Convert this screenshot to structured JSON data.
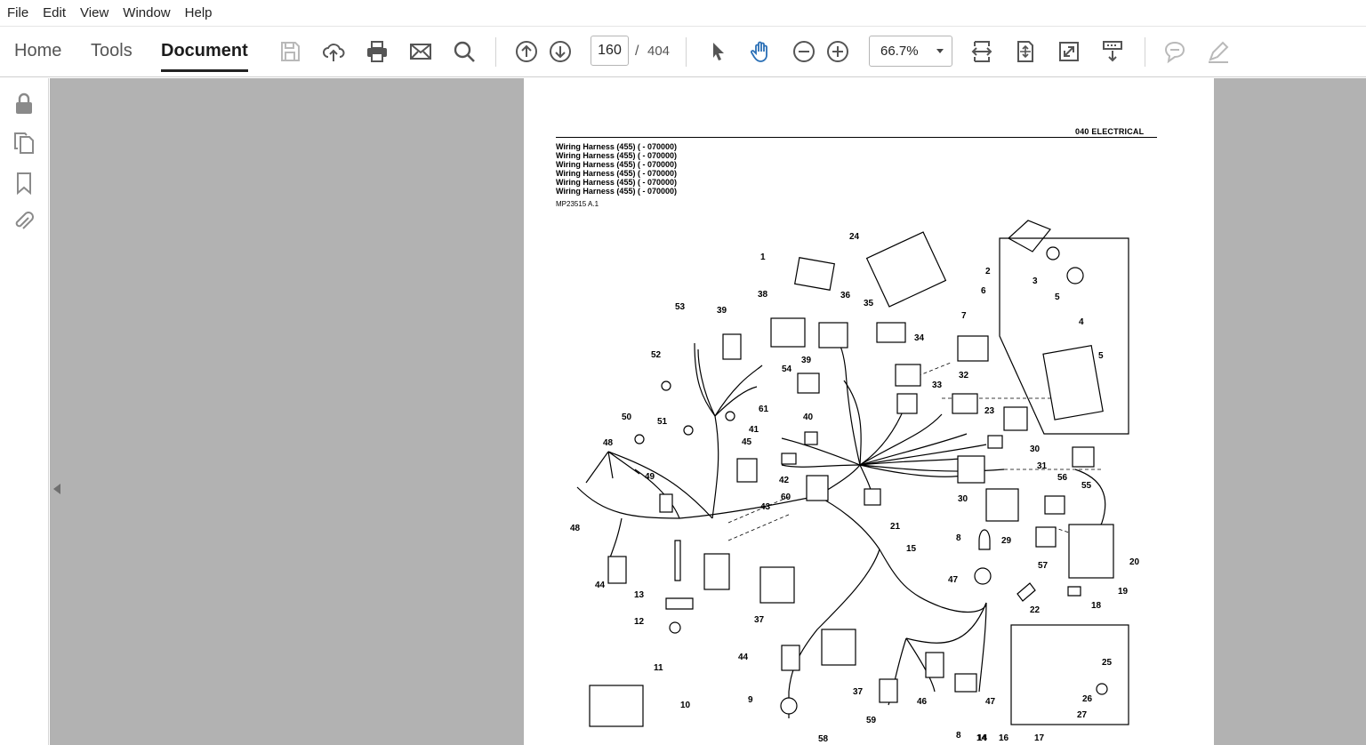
{
  "menu": [
    "File",
    "Edit",
    "View",
    "Window",
    "Help"
  ],
  "tabs": {
    "home": "Home",
    "tools": "Tools",
    "document": "Document"
  },
  "toolbar": {
    "page_current": "160",
    "page_separator": "/",
    "page_total": "404",
    "zoom": "66.7%"
  },
  "icons": {
    "save": "save-icon",
    "upload": "cloud-upload-icon",
    "print": "print-icon",
    "mail": "mail-icon",
    "search": "search-icon",
    "prev": "arrow-up-circle-icon",
    "next": "arrow-down-circle-icon",
    "select": "pointer-icon",
    "hand": "hand-icon",
    "zoom_out": "zoom-out-icon",
    "zoom_in": "zoom-in-icon",
    "comment": "comment-icon",
    "pen": "pen-icon"
  },
  "colors": {
    "accent_blue": "#2a6fb6",
    "doc_bg": "#b2b2b2",
    "disabled": "#b9b9b9"
  },
  "document": {
    "section": "040  ELECTRICAL",
    "harness_lines": [
      "Wiring Harness (455) ( - 070000)",
      "Wiring Harness (455) ( - 070000)",
      "Wiring Harness (455) ( - 070000)",
      "Wiring Harness (455) ( - 070000)",
      "Wiring Harness (455) ( - 070000)",
      "Wiring Harness (455) ( - 070000)"
    ],
    "figure_ref": "MP23515 A.1",
    "callouts": [
      "1",
      "2",
      "3",
      "4",
      "5",
      "5",
      "6",
      "7",
      "8",
      "8",
      "9",
      "10",
      "11",
      "12",
      "13",
      "14",
      "14",
      "15",
      "16",
      "17",
      "18",
      "19",
      "20",
      "21",
      "22",
      "23",
      "24",
      "25",
      "26",
      "27",
      "29",
      "30",
      "30",
      "31",
      "32",
      "33",
      "34",
      "35",
      "36",
      "37",
      "37",
      "38",
      "39",
      "39",
      "40",
      "41",
      "42",
      "43",
      "44",
      "44",
      "45",
      "46",
      "47",
      "47",
      "48",
      "48",
      "49",
      "50",
      "51",
      "52",
      "53",
      "54",
      "55",
      "56",
      "57",
      "58",
      "59",
      "60",
      "61"
    ]
  }
}
